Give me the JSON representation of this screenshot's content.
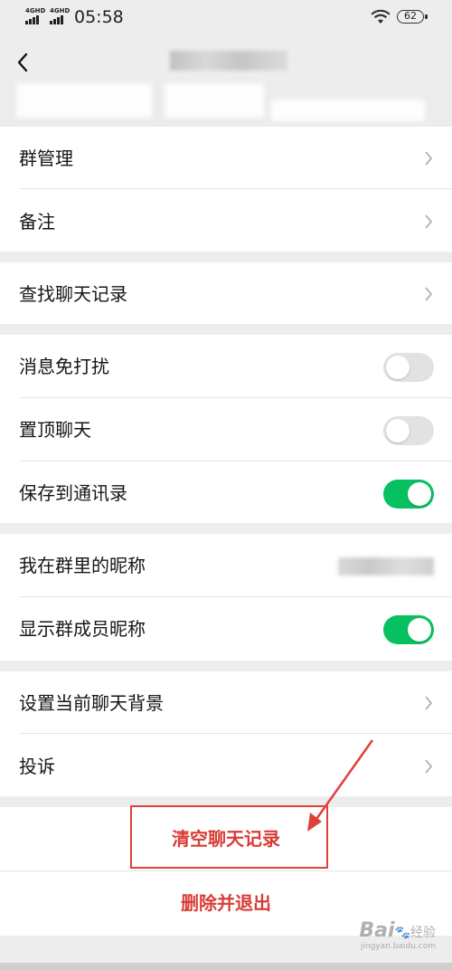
{
  "status_bar": {
    "network_1": "4GHD",
    "network_2": "4GHD",
    "time": "05:58",
    "battery": "62"
  },
  "nav": {
    "back_icon": "chevron-left-icon"
  },
  "sections": {
    "group_manage": {
      "label": "群管理",
      "icon": "chevron-right-icon"
    },
    "remark": {
      "label": "备注",
      "icon": "chevron-right-icon"
    },
    "search_history": {
      "label": "查找聊天记录",
      "icon": "chevron-right-icon"
    },
    "mute": {
      "label": "消息免打扰",
      "on": false
    },
    "pin": {
      "label": "置顶聊天",
      "on": false
    },
    "save_contacts": {
      "label": "保存到通讯录",
      "on": true
    },
    "my_nickname": {
      "label": "我在群里的昵称"
    },
    "show_nicknames": {
      "label": "显示群成员昵称",
      "on": true
    },
    "background": {
      "label": "设置当前聊天背景",
      "icon": "chevron-right-icon"
    },
    "complain": {
      "label": "投诉",
      "icon": "chevron-right-icon"
    }
  },
  "actions": {
    "clear_history": "清空聊天记录",
    "delete_exit": "删除并退出"
  },
  "colors": {
    "toggle_on": "#07c160",
    "toggle_off": "#e2e2e2",
    "danger_text": "#d93c36",
    "annotation_red": "#e0403a",
    "background": "#ededed"
  },
  "watermark": {
    "brand": "Bai",
    "cn": "经验",
    "url": "jingyan.baidu.com"
  }
}
